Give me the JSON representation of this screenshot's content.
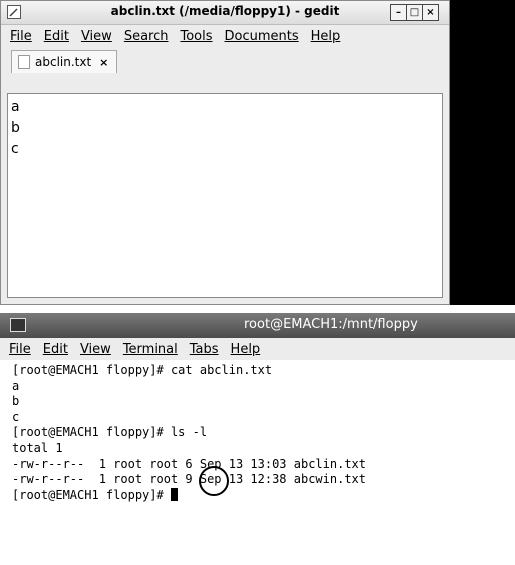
{
  "gedit": {
    "title": "abclin.txt (/media/floppy1) - gedit",
    "menu": [
      "File",
      "Edit",
      "View",
      "Search",
      "Tools",
      "Documents",
      "Help"
    ],
    "tab": {
      "label": "abclin.txt",
      "close": "×"
    },
    "lines": [
      "a",
      "b",
      "c"
    ]
  },
  "terminal": {
    "title": "root@EMACH1:/mnt/floppy",
    "menu": [
      "File",
      "Edit",
      "View",
      "Terminal",
      "Tabs",
      "Help"
    ],
    "lines": [
      "[root@EMACH1 floppy]# cat abclin.txt",
      "a",
      "b",
      "c",
      "[root@EMACH1 floppy]# ls -l",
      "total 1",
      "-rw-r--r--  1 root root 6 Sep 13 13:03 abclin.txt",
      "-rw-r--r--  1 root root 9 Sep 13 12:38 abcwin.txt"
    ],
    "prompt": "[root@EMACH1 floppy]# "
  }
}
